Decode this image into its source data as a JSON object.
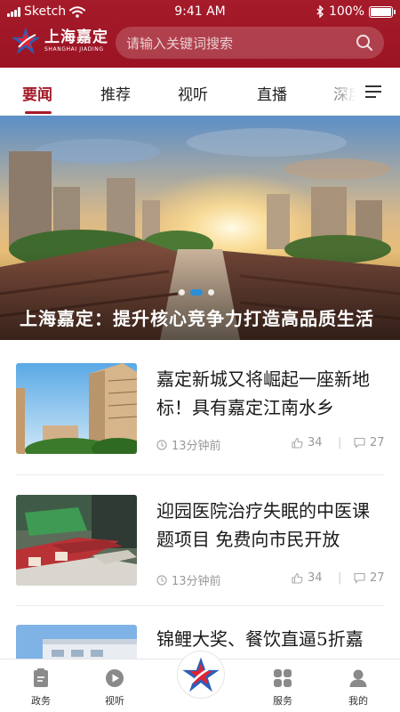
{
  "status_bar": {
    "carrier": "Sketch",
    "time": "9:41 AM",
    "battery": "100%",
    "battery_level": 1.0
  },
  "brand": {
    "name_cn": "上海嘉定",
    "name_en": "SHANGHAI JIADING",
    "accent_color": "#a51b2a"
  },
  "search": {
    "placeholder": "请输入关键词搜索"
  },
  "tabs": [
    {
      "label": "要闻",
      "active": true
    },
    {
      "label": "推荐",
      "active": false
    },
    {
      "label": "视听",
      "active": false
    },
    {
      "label": "直播",
      "active": false
    },
    {
      "label": "深度",
      "active": false
    }
  ],
  "banner": {
    "title": "上海嘉定：提升核心竞争力打造高品质生活",
    "slide_count": 3,
    "active_slide": 2
  },
  "news": [
    {
      "title": "嘉定新城又将崛起一座新地标！具有嘉定江南水乡",
      "time": "13分钟前",
      "likes": "34",
      "comments": "27",
      "thumb": "high-rise-buildings"
    },
    {
      "title": "迎园医院治疗失眠的中医课题项目 免费向市民开放",
      "time": "13分钟前",
      "likes": "34",
      "comments": "27",
      "thumb": "medical-devices"
    },
    {
      "title": "锦鲤大奖、餐饮直逼5折嘉",
      "thumb": "building"
    }
  ],
  "bottom_nav": [
    {
      "label": "政务",
      "icon": "document-icon"
    },
    {
      "label": "视听",
      "icon": "play-icon"
    },
    {
      "label": "",
      "icon": "home-logo-icon"
    },
    {
      "label": "服务",
      "icon": "grid-icon"
    },
    {
      "label": "我的",
      "icon": "user-icon"
    }
  ]
}
